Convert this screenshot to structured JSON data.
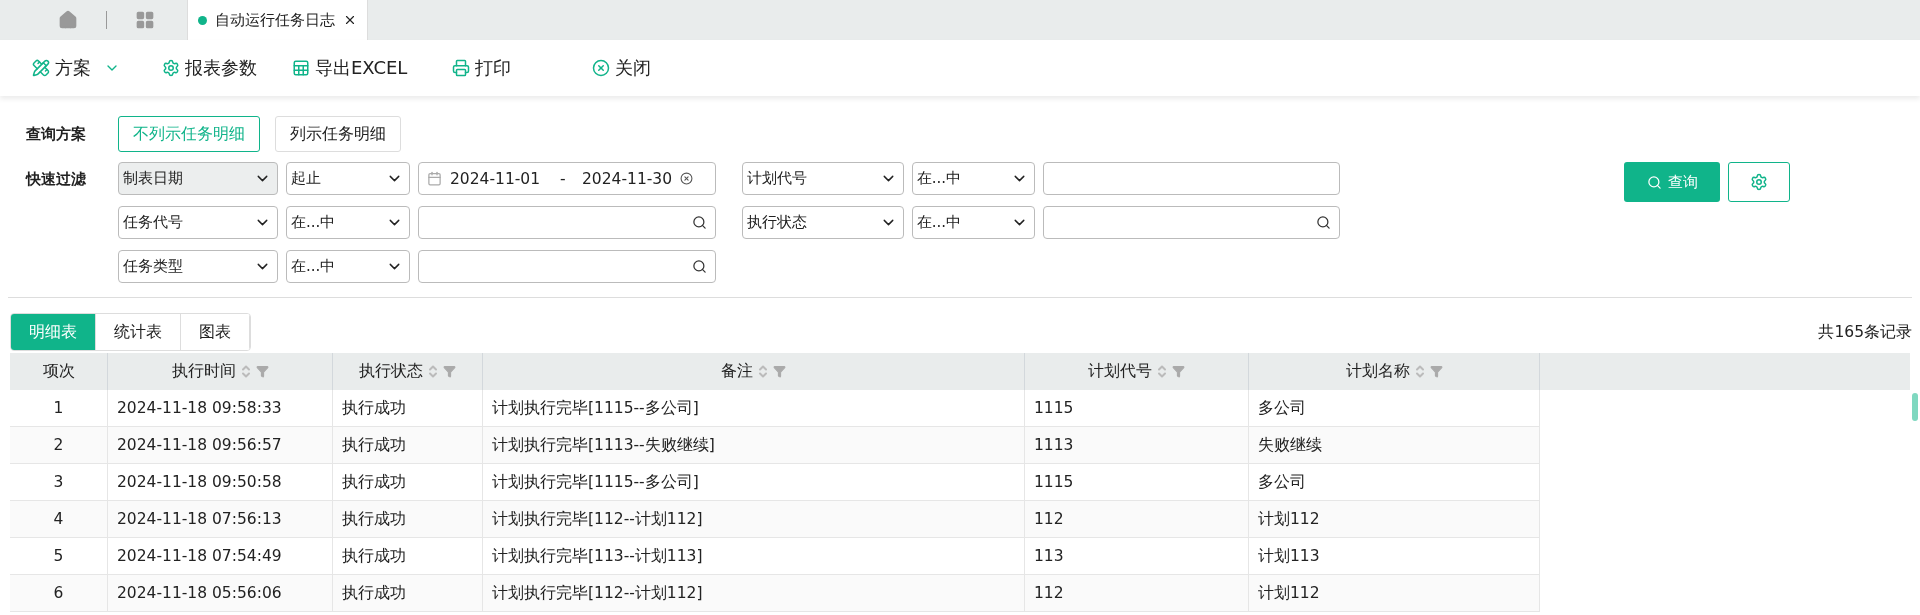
{
  "page_tabs": [
    {
      "kind": "home",
      "selected": false
    },
    {
      "kind": "apps",
      "selected": false
    },
    {
      "kind": "doc",
      "label": "自动运行任务日志",
      "selected": true
    }
  ],
  "toolbar": [
    {
      "kind": "plan",
      "label": "方案"
    },
    {
      "kind": "gear",
      "label": "报表参数"
    },
    {
      "kind": "excel",
      "label": "导出EXCEL"
    },
    {
      "kind": "print",
      "label": "打印"
    },
    {
      "kind": "close",
      "label": "关闭"
    }
  ],
  "query_plan": {
    "label": "查询方案",
    "options": [
      {
        "label": "不列示任务明细",
        "selected": true
      },
      {
        "label": "列示任务明细",
        "selected": false
      }
    ]
  },
  "quick_filter": {
    "label": "快速过滤",
    "rows": [
      [
        {
          "field": "制表日期",
          "operator": "起止",
          "kind": "date_range",
          "from": "2024-11-01",
          "separator": "-",
          "to": "2024-11-30"
        },
        {
          "field": "计划代号",
          "operator": "在...中",
          "kind": "text"
        }
      ],
      [
        {
          "field": "任务代号",
          "operator": "在...中",
          "kind": "search"
        },
        {
          "field": "执行状态",
          "operator": "在...中",
          "kind": "search"
        }
      ],
      [
        {
          "field": "任务类型",
          "operator": "在...中",
          "kind": "search"
        }
      ]
    ],
    "query_button": "查询"
  },
  "view_tabs": [
    {
      "label": "明细表",
      "selected": true
    },
    {
      "label": "统计表",
      "selected": false
    },
    {
      "label": "图表",
      "selected": false
    }
  ],
  "record_count": "共165条记录",
  "table": {
    "columns": [
      {
        "label": "项次",
        "sortable": false
      },
      {
        "label": "执行时间",
        "sortable": true
      },
      {
        "label": "执行状态",
        "sortable": true
      },
      {
        "label": "备注",
        "sortable": true
      },
      {
        "label": "计划代号",
        "sortable": true
      },
      {
        "label": "计划名称",
        "sortable": true
      }
    ],
    "rows": [
      [
        "1",
        "2024-11-18 09:58:33",
        "执行成功",
        "计划执行完毕[1115--多公司]",
        "1115",
        "多公司"
      ],
      [
        "2",
        "2024-11-18 09:56:57",
        "执行成功",
        "计划执行完毕[1113--失败继续]",
        "1113",
        "失败继续"
      ],
      [
        "3",
        "2024-11-18 09:50:58",
        "执行成功",
        "计划执行完毕[1115--多公司]",
        "1115",
        "多公司"
      ],
      [
        "4",
        "2024-11-18 07:56:13",
        "执行成功",
        "计划执行完毕[112--计划112]",
        "112",
        "计划112"
      ],
      [
        "5",
        "2024-11-18 07:54:49",
        "执行成功",
        "计划执行完毕[113--计划113]",
        "113",
        "计划113"
      ],
      [
        "6",
        "2024-11-18 05:56:06",
        "执行成功",
        "计划执行完毕[112--计划112]",
        "112",
        "计划112"
      ]
    ]
  }
}
